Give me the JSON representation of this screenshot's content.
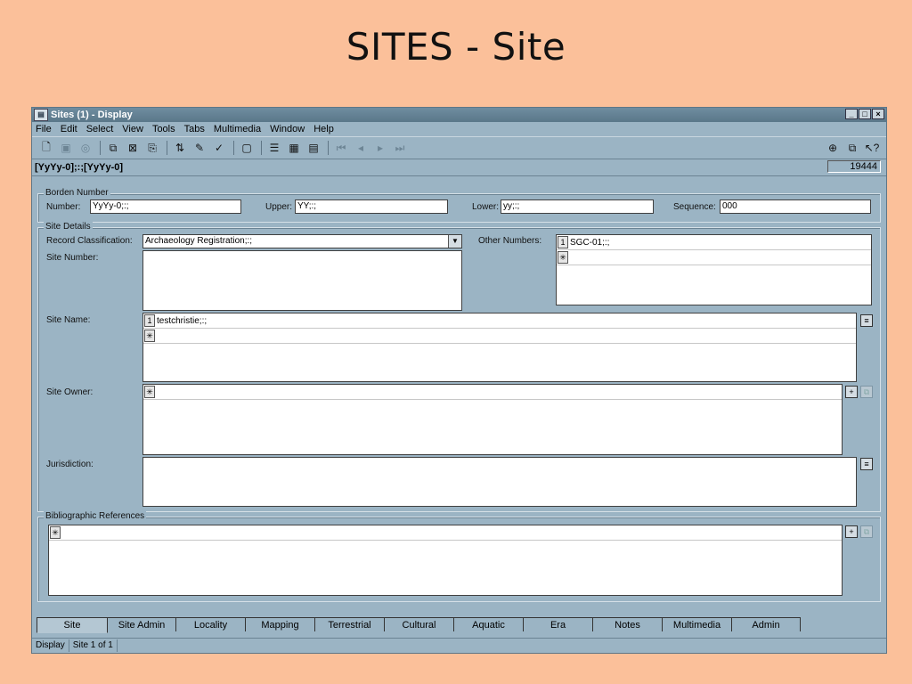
{
  "slide": {
    "title": "SITES - Site"
  },
  "window": {
    "title": "Sites (1) - Display",
    "controls": {
      "minimize": "_",
      "maximize": "□",
      "close": "×"
    }
  },
  "menu": [
    "File",
    "Edit",
    "Select",
    "View",
    "Tools",
    "Tabs",
    "Multimedia",
    "Window",
    "Help"
  ],
  "toolbar": {
    "icons": [
      "new-icon",
      "save-icon",
      "refresh-icon",
      "copy-icon",
      "delete-icon",
      "record-icon",
      "sort-icon",
      "report-icon",
      "spellcheck-icon",
      "detail-icon",
      "form-view-icon",
      "grid-view-icon",
      "page-view-icon",
      "first-record-icon",
      "prev-record-icon",
      "next-record-icon",
      "last-record-icon"
    ],
    "right_icons": [
      "attach-icon",
      "copy-record-icon",
      "help-pointer-icon"
    ]
  },
  "record": {
    "code": "[YyYy-0];:;[YyYy-0]",
    "count": "19444"
  },
  "borden": {
    "group_label": "Borden Number",
    "number_label": "Number:",
    "number_value": "YyYy-0;:;",
    "upper_label": "Upper:",
    "upper_value": "YY;:;",
    "lower_label": "Lower:",
    "lower_value": "yy;:;",
    "sequence_label": "Sequence:",
    "sequence_value": "000"
  },
  "site_details": {
    "group_label": "Site Details",
    "record_class_label": "Record Classification:",
    "record_class_value": "Archaeology Registration;:;",
    "other_numbers_label": "Other Numbers:",
    "other_numbers": [
      {
        "n": "1",
        "value": "SGC-01;:;"
      }
    ],
    "site_number_label": "Site Number:",
    "site_name_label": "Site Name:",
    "site_names": [
      {
        "n": "1",
        "value": "testchristie;:;"
      }
    ],
    "site_owner_label": "Site Owner:",
    "jurisdiction_label": "Jurisdiction:",
    "new_row_marker": "✳"
  },
  "biblio": {
    "group_label": "Bibliographic References"
  },
  "tabs": [
    "Site",
    "Site Admin",
    "Locality",
    "Mapping",
    "Terrestrial",
    "Cultural",
    "Aquatic",
    "Era",
    "Notes",
    "Multimedia",
    "Admin"
  ],
  "active_tab": "Site",
  "status": {
    "mode": "Display",
    "position": "Site 1 of 1"
  }
}
